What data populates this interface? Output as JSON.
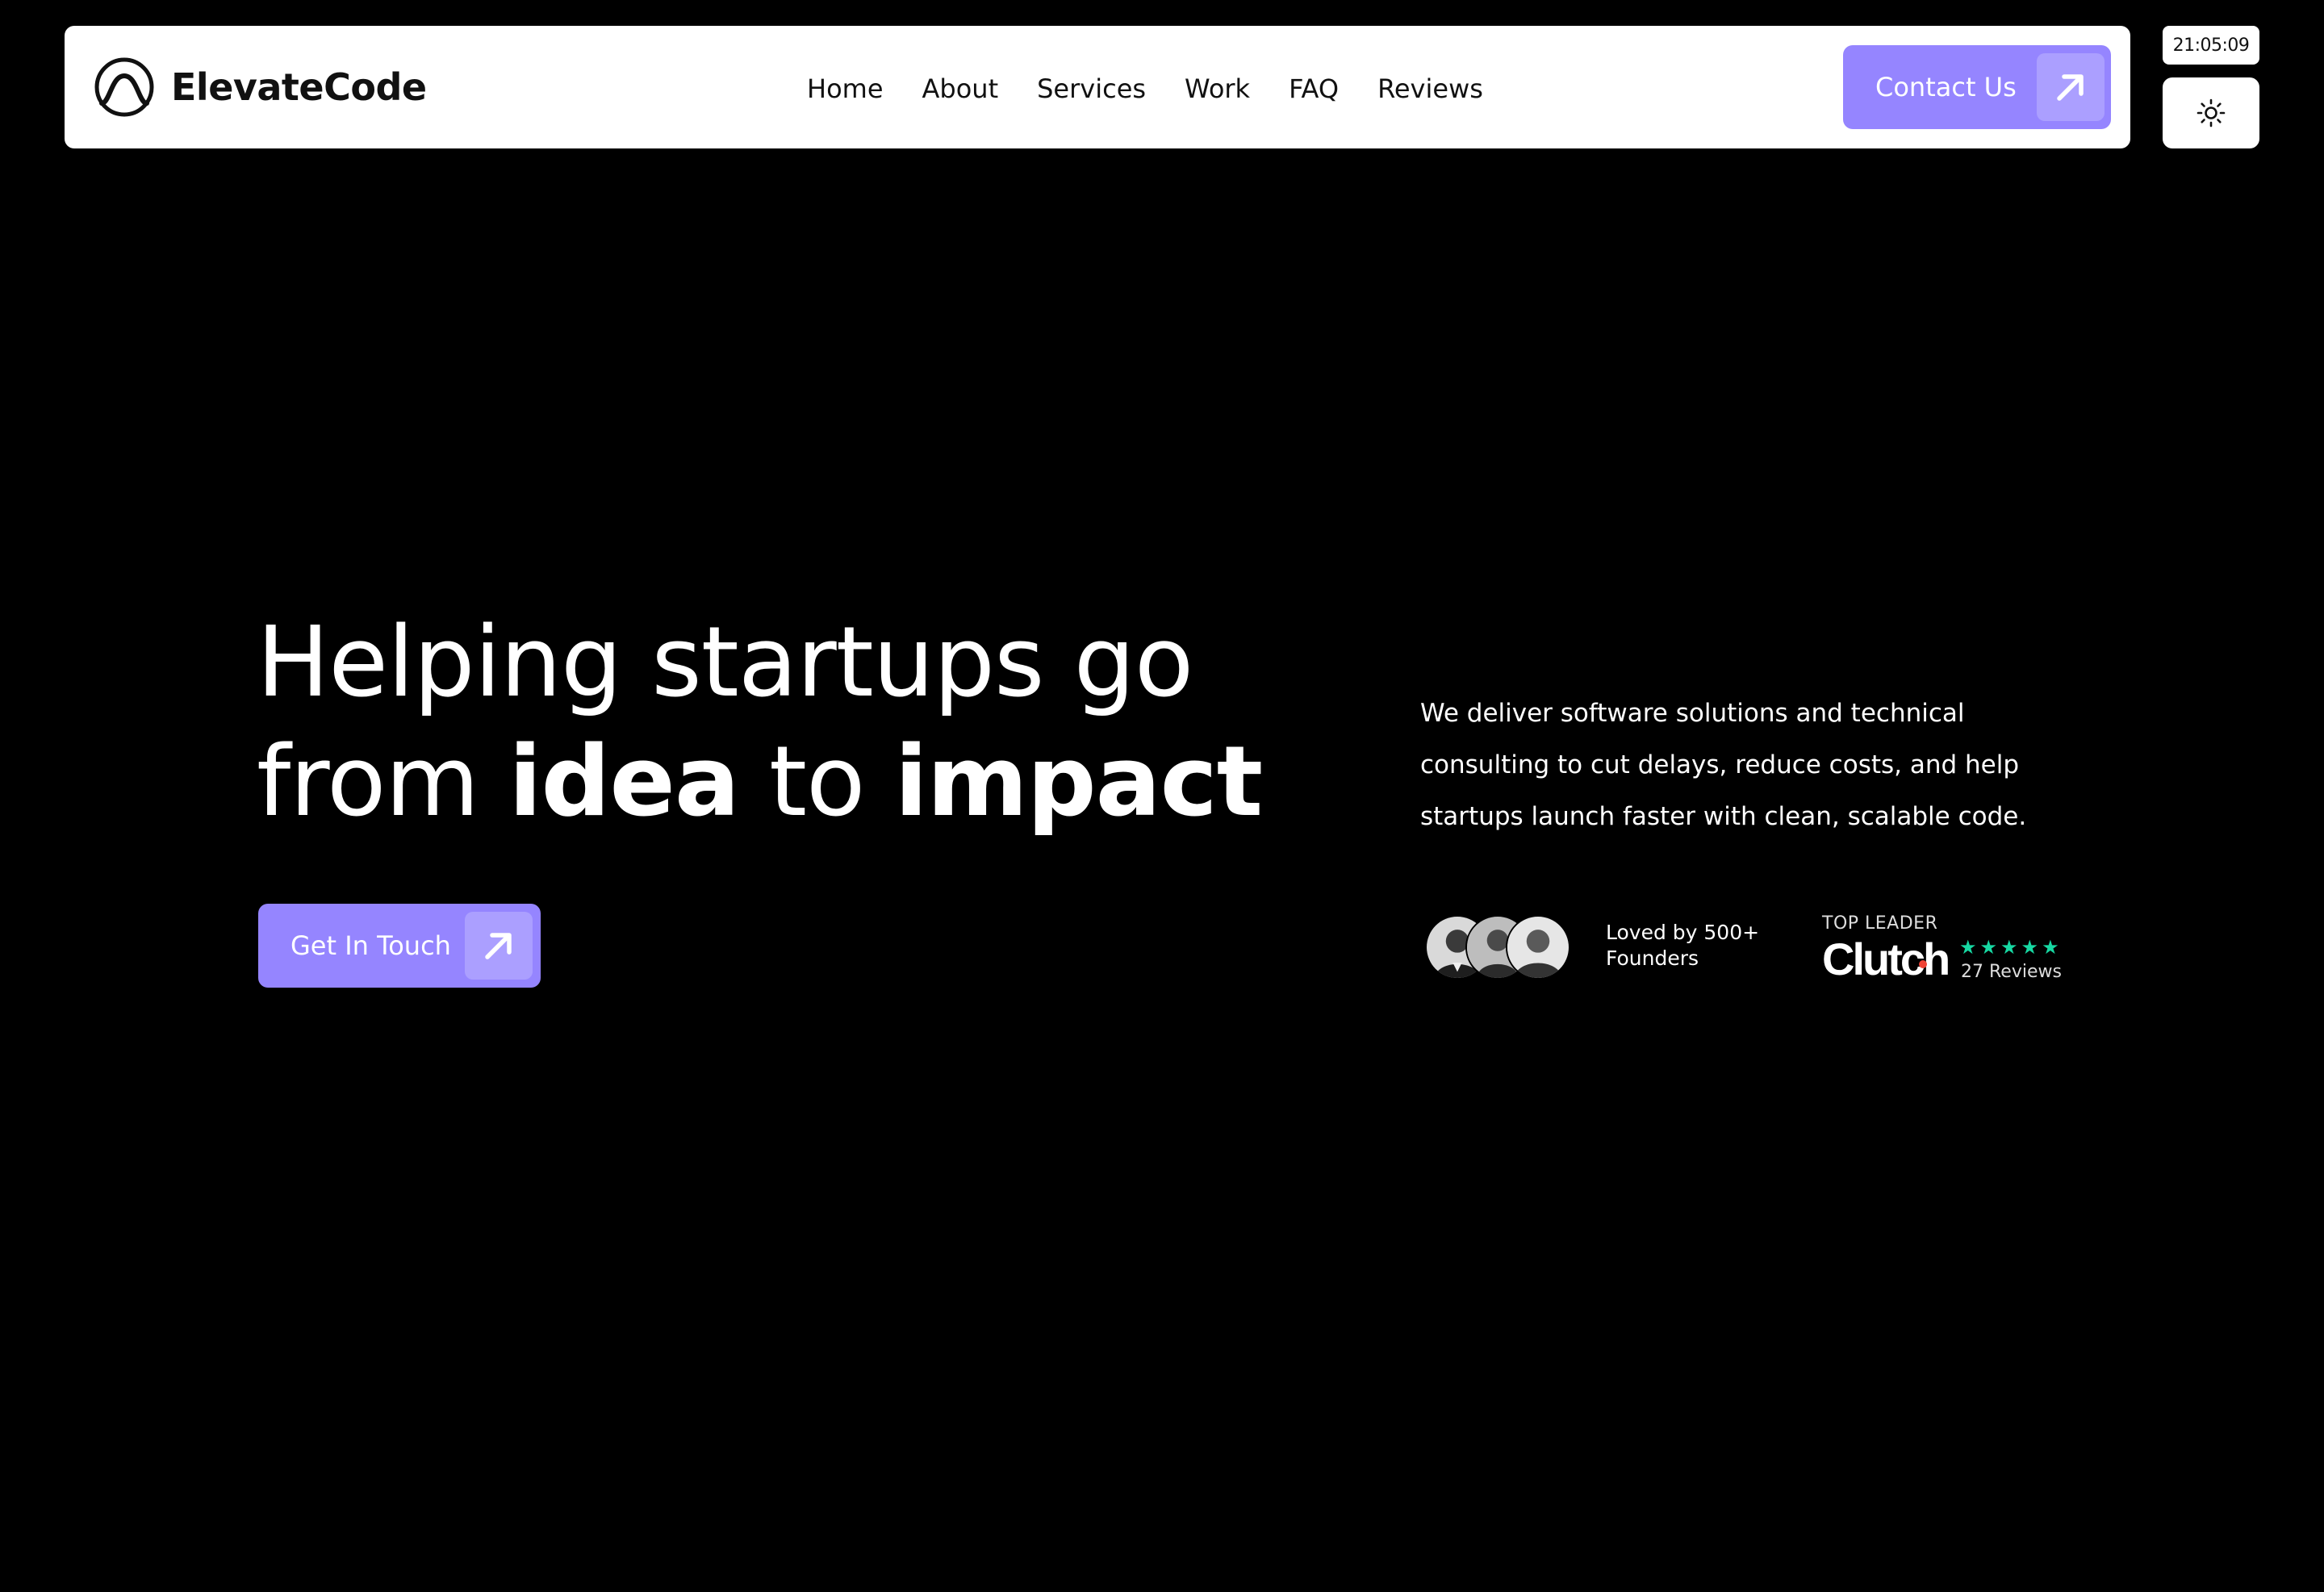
{
  "brand": {
    "name": "ElevateCode",
    "logo_icon": "mountain-arch-icon"
  },
  "nav": {
    "items": [
      {
        "label": "Home"
      },
      {
        "label": "About"
      },
      {
        "label": "Services"
      },
      {
        "label": "Work"
      },
      {
        "label": "FAQ"
      },
      {
        "label": "Reviews"
      }
    ],
    "contact_label": "Contact Us",
    "contact_icon": "arrow-up-right-icon"
  },
  "widgets": {
    "clock": "21:05:09",
    "theme_icon": "sun-icon"
  },
  "hero": {
    "line1": "Helping startups go",
    "from": "from ",
    "idea": "idea",
    "to": " to ",
    "impact": "impact",
    "cta_label": "Get In Touch",
    "cta_icon": "arrow-up-right-icon",
    "description": "We deliver software solutions and technical consulting to cut delays, reduce costs, and help startups launch faster with clean, scalable code."
  },
  "social_proof": {
    "loved_line1": "Loved by 500+",
    "loved_line2": "Founders",
    "clutch_label": "TOP LEADER",
    "clutch_logo": "Clutch",
    "stars": 5,
    "reviews": "27 Reviews"
  },
  "colors": {
    "background": "#000000",
    "accent": "#9585ff",
    "accent_light": "#ab9fff",
    "star": "#17d9a3",
    "clutch_dot": "#ef4335"
  }
}
